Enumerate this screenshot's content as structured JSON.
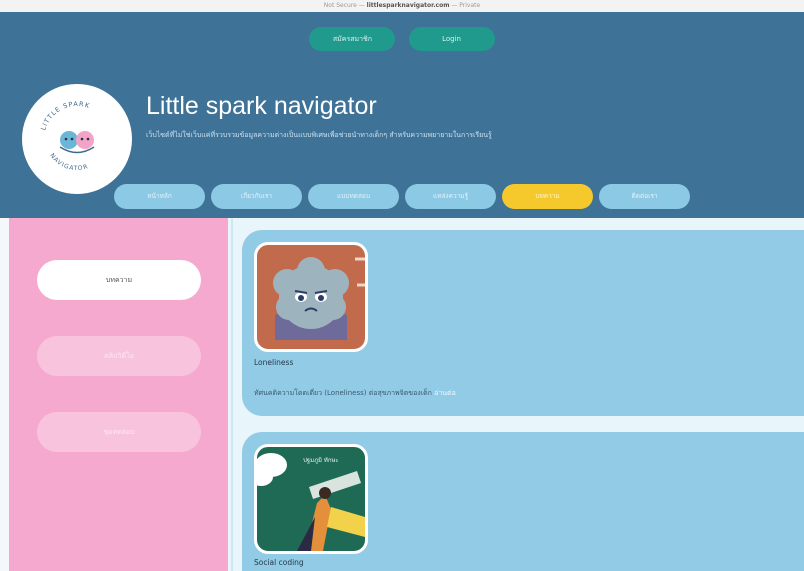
{
  "browser": {
    "prefix": "Not Secure — ",
    "domain": "littlesparknavigator.com",
    "suffix": " — Private"
  },
  "header": {
    "auth_buttons": [
      "สมัครสมาชิก",
      "Login"
    ],
    "title": "Little spark navigator",
    "subtitle": "เว็บไซต์ที่ไม่ใช่เว็บแค่ที่รวบรวมข้อมูลความต่างเป็นแบบพิเศษเพื่อช่วยนำทางเด็กๆ สำหรับความพยายามในการเรียนรู้",
    "logo_text": "LITTLE SPARK NAVIGATOR"
  },
  "nav": {
    "tabs": [
      {
        "label": "หน้าหลัก",
        "active": false
      },
      {
        "label": "เกี่ยวกับเรา",
        "active": false
      },
      {
        "label": "แบบทดสอบ",
        "active": false
      },
      {
        "label": "แหล่งความรู้",
        "active": false
      },
      {
        "label": "บทความ",
        "active": true
      },
      {
        "label": "ติดต่อเรา",
        "active": false
      }
    ]
  },
  "sidebar": {
    "items": [
      "บทความ",
      "คลิปวิดีโอ",
      "ชุดทดสอบ"
    ]
  },
  "articles": [
    {
      "title": "Loneliness",
      "description": "ทัศนคติความโดดเดี่ยว (Loneliness) ต่อสุขภาพจิตของเด็ก",
      "read_more": "อ่านต่อ"
    },
    {
      "title": "Social coding",
      "thumb_caption": "ปฐมภูมิ ทักษะ"
    }
  ],
  "colors": {
    "header_bg": "#3f7297",
    "auth_button": "#1f9a8d",
    "nav_tab": "#8cc9e4",
    "nav_tab_active": "#f5c92b",
    "sidebar_bg": "#f6a9cf",
    "card_bg": "#92cbe5"
  }
}
